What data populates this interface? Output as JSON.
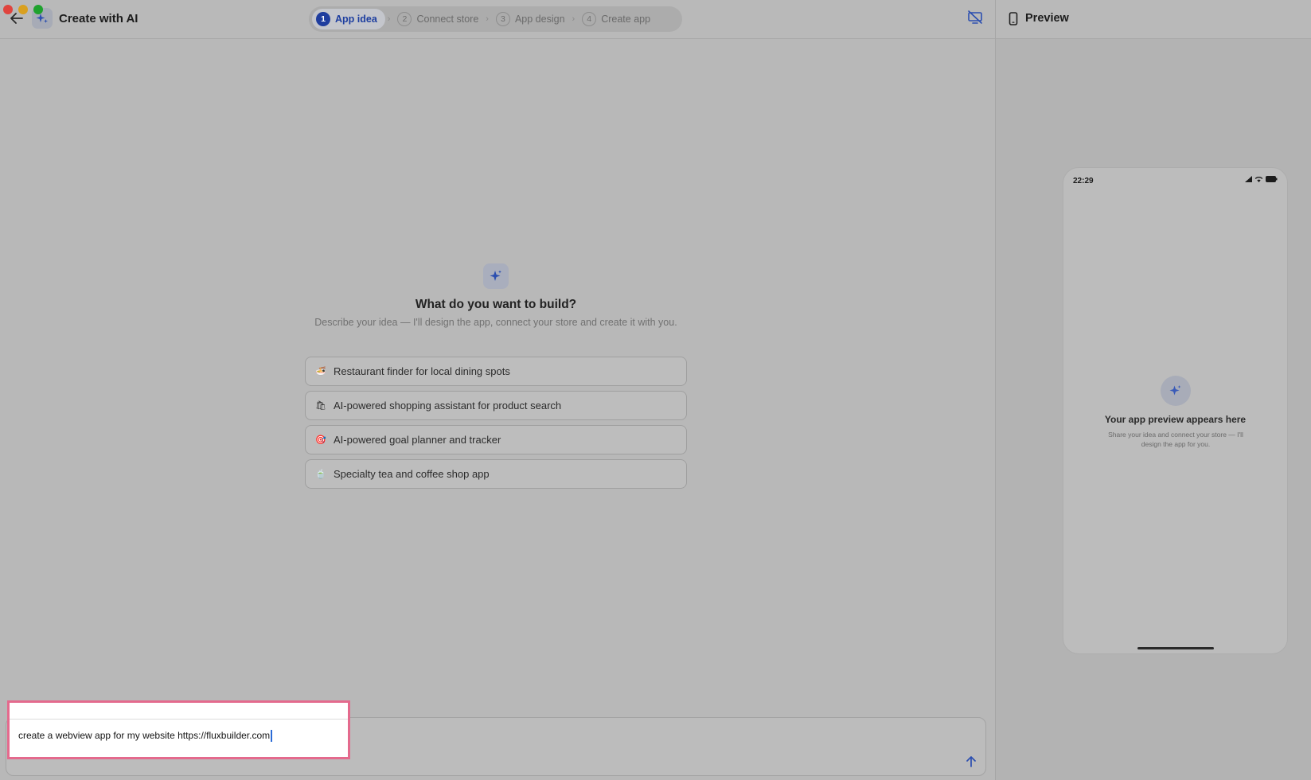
{
  "header": {
    "title": "Create with AI",
    "steps": [
      {
        "num": "1",
        "label": "App idea",
        "active": true
      },
      {
        "num": "2",
        "label": "Connect store",
        "active": false
      },
      {
        "num": "3",
        "label": "App design",
        "active": false
      },
      {
        "num": "4",
        "label": "Create app",
        "active": false
      }
    ]
  },
  "main": {
    "heading": "What do you want to build?",
    "subheading": "Describe your idea — I'll design the app, connect your store and create it with you.",
    "suggestions": [
      {
        "emoji": "🍜",
        "label": "Restaurant finder for local dining spots"
      },
      {
        "emoji": "🛍",
        "label": "AI-powered shopping assistant for product search"
      },
      {
        "emoji": "🎯",
        "label": "AI-powered goal planner and tracker"
      },
      {
        "emoji": "🍵",
        "label": "Specialty tea and coffee shop app"
      }
    ]
  },
  "composer": {
    "value": "create a webview app for my website https://fluxbuilder.com"
  },
  "preview": {
    "title": "Preview",
    "phone_time": "22:29",
    "empty_title": "Your app preview appears here",
    "empty_sub": "Share your idea and connect your store — I'll design the app for you."
  },
  "colors": {
    "accent": "#1f3d9e",
    "highlight_border": "#e46a8d"
  }
}
